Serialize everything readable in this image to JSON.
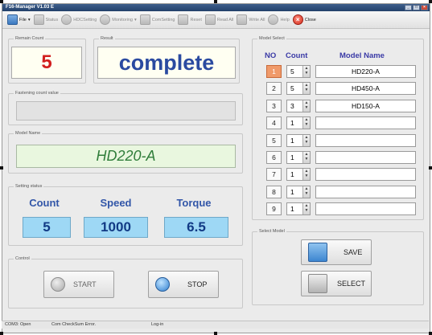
{
  "window": {
    "title": "F16-Manager V1.03 E"
  },
  "toolbar": [
    {
      "name": "file",
      "label": "File",
      "enabled": true,
      "icon": "file-icon"
    },
    {
      "name": "status",
      "label": "Status",
      "enabled": false,
      "icon": "home-icon"
    },
    {
      "name": "hdcsetting",
      "label": "HDCSetting",
      "enabled": false,
      "icon": "settings-icon"
    },
    {
      "name": "monitoring",
      "label": "Monitoring",
      "enabled": false,
      "icon": "monitor-icon"
    },
    {
      "name": "comsetting",
      "label": "ComSetting",
      "enabled": false,
      "icon": "plug-icon"
    },
    {
      "name": "reset",
      "label": "Reset",
      "enabled": false,
      "icon": "reset-icon"
    },
    {
      "name": "readall",
      "label": "Read All",
      "enabled": false,
      "icon": "upload-icon"
    },
    {
      "name": "writeall",
      "label": "Write All",
      "enabled": false,
      "icon": "download-icon"
    },
    {
      "name": "help",
      "label": "Help",
      "enabled": false,
      "icon": "help-icon"
    },
    {
      "name": "close",
      "label": "Close",
      "enabled": true,
      "icon": "close-icon"
    }
  ],
  "remain": {
    "label": "Remain Count",
    "value": "5"
  },
  "result": {
    "label": "Result",
    "value": "complete"
  },
  "fastening": {
    "label": "Fastening count value",
    "value": ""
  },
  "model": {
    "label": "Model Name",
    "value": "HD220-A"
  },
  "setting": {
    "label": "Setting status",
    "count_label": "Count",
    "count_value": "5",
    "speed_label": "Speed",
    "speed_value": "1000",
    "torque_label": "Torque",
    "torque_value": "6.5"
  },
  "control": {
    "label": "Control",
    "start_label": "START",
    "stop_label": "STOP"
  },
  "model_select": {
    "label": "Model Select",
    "headers": {
      "no": "NO",
      "count": "Count",
      "model_name": "Model Name"
    },
    "rows": [
      {
        "no": "1",
        "count": "5",
        "model": "HD220-A",
        "active": true
      },
      {
        "no": "2",
        "count": "5",
        "model": "HD450-A",
        "active": false
      },
      {
        "no": "3",
        "count": "3",
        "model": "HD150-A",
        "active": false
      },
      {
        "no": "4",
        "count": "1",
        "model": "",
        "active": false
      },
      {
        "no": "5",
        "count": "1",
        "model": "",
        "active": false
      },
      {
        "no": "6",
        "count": "1",
        "model": "",
        "active": false
      },
      {
        "no": "7",
        "count": "1",
        "model": "",
        "active": false
      },
      {
        "no": "8",
        "count": "1",
        "model": "",
        "active": false
      },
      {
        "no": "9",
        "count": "1",
        "model": "",
        "active": false
      }
    ]
  },
  "select_model": {
    "label": "Select Model",
    "save_label": "SAVE",
    "select_label": "SELECT"
  },
  "statusbar": {
    "port": "COM3: Open",
    "checksum": "Com CheckSum Error.",
    "login": "Log-in"
  },
  "colors": {
    "accent_blue": "#3256a8",
    "remain_red": "#d21f1f",
    "model_green": "#2f7d3a",
    "active_row": "#f09a6a",
    "value_bg": "#9ed8f5"
  }
}
